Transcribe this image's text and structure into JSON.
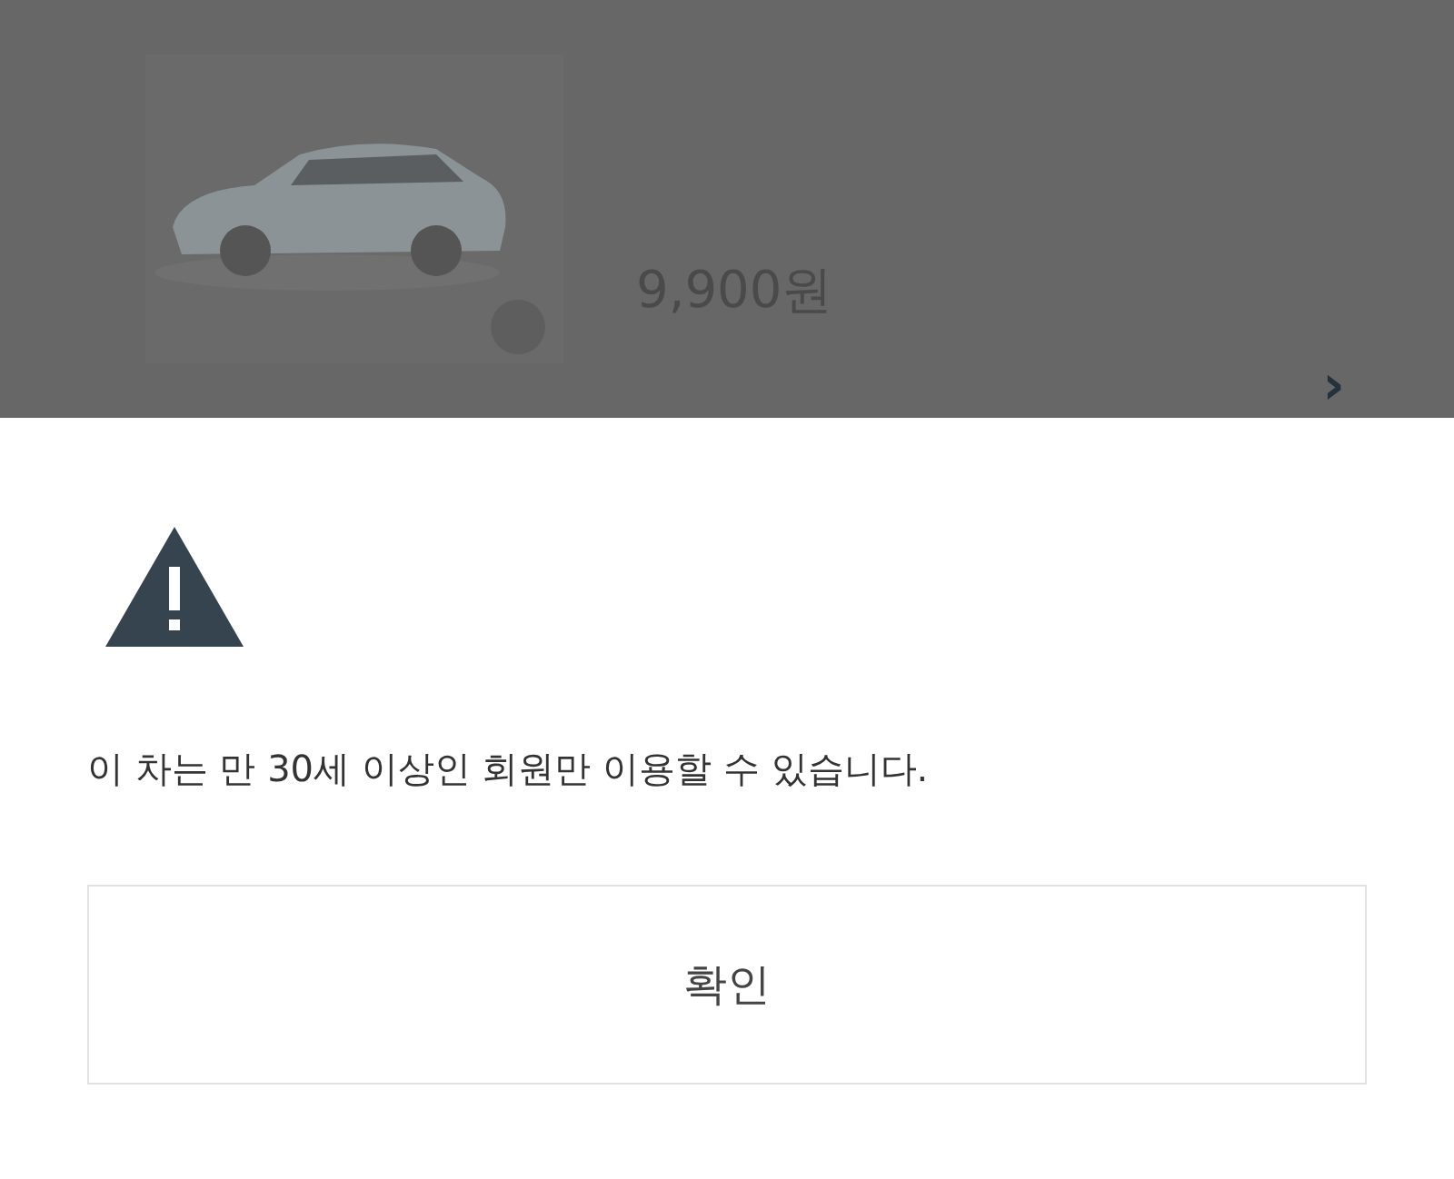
{
  "background_card": {
    "kind": "picture",
    "price": "9,900원",
    "chevron": "›"
  },
  "dialog": {
    "message": "이 차는 만 30세 이상인 회원만 이용할 수 있습니다.",
    "confirm_button": "확인"
  }
}
